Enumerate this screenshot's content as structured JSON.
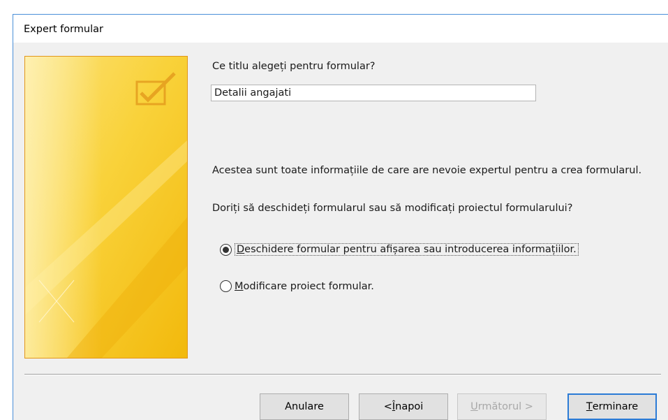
{
  "window": {
    "title": "Expert formular"
  },
  "form": {
    "title_prompt": "Ce titlu alegeți pentru formular?",
    "title_value": "Detalii angajati",
    "info_text": "Acestea sunt toate informațiile de care are nevoie expertul pentru a crea formularul.",
    "question": "Doriți să deschideți formularul sau să modificați proiectul formularului?",
    "options": [
      {
        "accel": "D",
        "rest": "eschidere formular pentru afișarea sau introducerea informațiilor.",
        "checked": true
      },
      {
        "accel": "M",
        "rest": "odificare proiect formular.",
        "checked": false
      }
    ]
  },
  "buttons": {
    "cancel": "Anulare",
    "back_prefix": "< ",
    "back_accel": "Î",
    "back_rest": "napoi",
    "next_accel": "U",
    "next_rest": "rmătorul >",
    "finish_accel": "T",
    "finish_rest": "erminare"
  },
  "colors": {
    "art_yellow": "#f7c81e",
    "art_border": "#e1961a",
    "default_button_border": "#2b7bd6"
  },
  "icons": {
    "side_art": "checkbox-check-icon"
  }
}
